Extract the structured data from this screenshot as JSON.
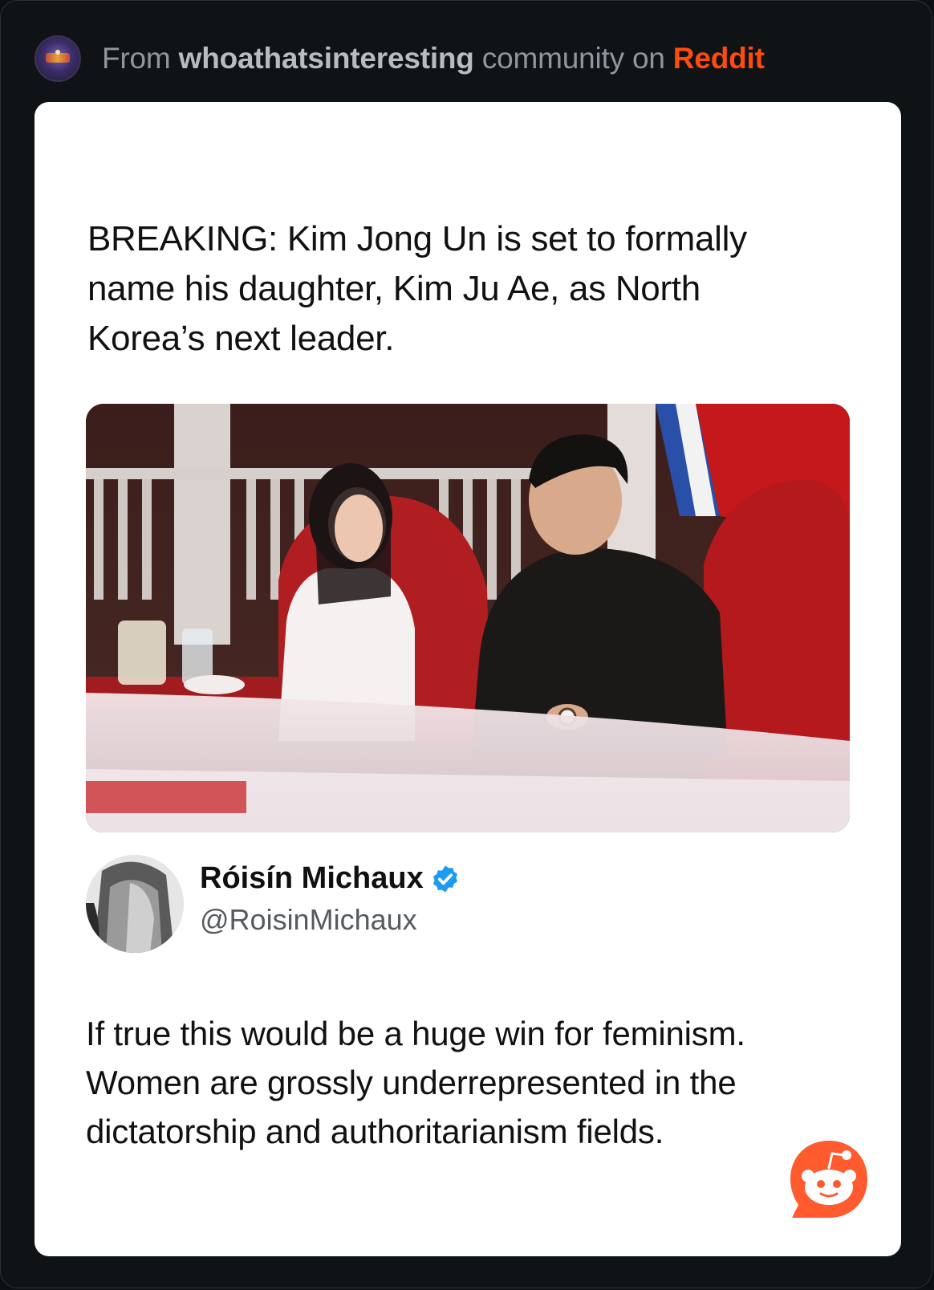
{
  "header": {
    "prefix": "From ",
    "community": "whoathatsinteresting",
    "middle": " community on ",
    "platform": "Reddit",
    "avatar_icon": "community-avatar-icon",
    "platform_color": "#ff4a0d"
  },
  "post": {
    "headline": "BREAKING: Kim Jong Un is set to formally name his daughter, Kim Ju Ae, as North Korea’s next leader.",
    "photo_icon": "news-photo",
    "tweet": {
      "author_name": "Róisín Michaux",
      "author_handle": "@RoisinMichaux",
      "verified": true,
      "verified_color": "#1d9bf0",
      "text": "If true this would be a huge win for feminism. Women are grossly underrepresented in the dictatorship and authoritarianism fields."
    }
  },
  "watermark": {
    "icon": "reddit-snoo-icon",
    "color": "#ff5b2e"
  }
}
